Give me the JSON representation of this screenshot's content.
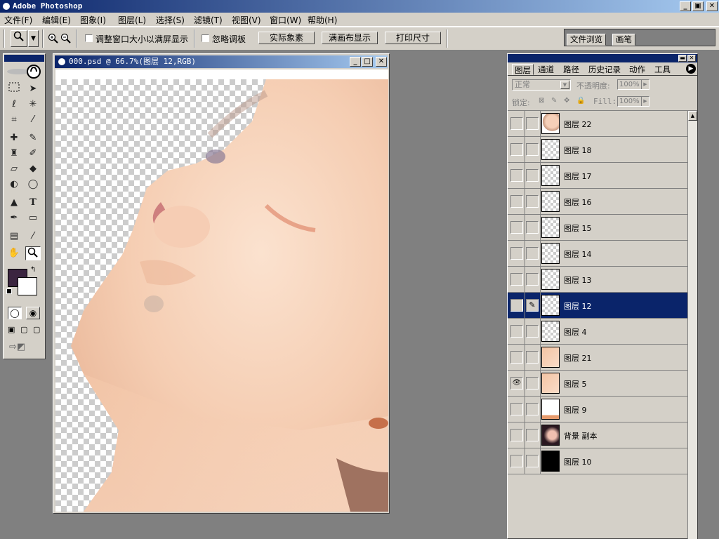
{
  "app": {
    "title": "Adobe Photoshop",
    "window_controls": [
      "_",
      "▣",
      "✕"
    ]
  },
  "menu": [
    "文件(F)",
    "编辑(E)",
    "图象(I)",
    "图层(L)",
    "选择(S)",
    "滤镜(T)",
    "视图(V)",
    "窗口(W)",
    "帮助(H)"
  ],
  "options": {
    "resize_windows_label": "调整窗口大小以满屏显示",
    "ignore_palettes_label": "忽略调板",
    "actual_pixels": "实际象素",
    "fit_on_screen": "满画布显示",
    "print_size": "打印尺寸",
    "palette_tabs": [
      "文件浏览",
      "画笔"
    ]
  },
  "document": {
    "title": "000.psd @ 66.7%(图层 12,RGB)",
    "window_controls": [
      "_",
      "□",
      "✕"
    ]
  },
  "layers_panel": {
    "tabs": [
      "图层",
      "通道",
      "路径",
      "历史记录",
      "动作",
      "工具"
    ],
    "blend_mode": "正常",
    "opacity_label": "不透明度:",
    "opacity_value": "100%",
    "lock_label": "锁定:",
    "fill_label": "Fill:",
    "fill_value": "100%",
    "layers": [
      {
        "name": "图层 22",
        "visible": false,
        "selected": false,
        "thumb": "face"
      },
      {
        "name": "图层 18",
        "visible": false,
        "selected": false,
        "thumb": "empty"
      },
      {
        "name": "图层 17",
        "visible": false,
        "selected": false,
        "thumb": "empty"
      },
      {
        "name": "图层 16",
        "visible": false,
        "selected": false,
        "thumb": "empty"
      },
      {
        "name": "图层 15",
        "visible": false,
        "selected": false,
        "thumb": "empty"
      },
      {
        "name": "图层 14",
        "visible": false,
        "selected": false,
        "thumb": "empty"
      },
      {
        "name": "图层 13",
        "visible": false,
        "selected": false,
        "thumb": "empty"
      },
      {
        "name": "图层 12",
        "visible": false,
        "selected": true,
        "thumb": "empty"
      },
      {
        "name": "图层 4",
        "visible": false,
        "selected": false,
        "thumb": "empty"
      },
      {
        "name": "图层 21",
        "visible": false,
        "selected": false,
        "thumb": "skin"
      },
      {
        "name": "图层 5",
        "visible": true,
        "selected": false,
        "thumb": "skin"
      },
      {
        "name": "图层 9",
        "visible": false,
        "selected": false,
        "thumb": "partial"
      },
      {
        "name": "背景 副本",
        "visible": false,
        "selected": false,
        "thumb": "photo"
      },
      {
        "name": "图层 10",
        "visible": false,
        "selected": false,
        "thumb": "black"
      }
    ]
  },
  "colors": {
    "foreground": "#3b2540",
    "background": "#ffffff",
    "selection": "#0a246a",
    "skin": "#f4c9ac"
  },
  "icons": [
    "zoom-in-icon",
    "zoom-out-icon",
    "eye-icon",
    "brush-icon",
    "lock-icon"
  ]
}
